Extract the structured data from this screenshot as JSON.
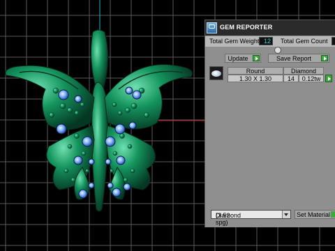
{
  "panel": {
    "title": "GEM REPORTER",
    "total_weight_label": "Total Gem Weight",
    "total_weight_value": "12",
    "total_count_label": "Total Gem Count",
    "update_label": "Update",
    "save_report_label": "Save Report",
    "table": {
      "columns": [
        "Round",
        "Diamond"
      ],
      "rows": [
        {
          "size": "1.30 X 1.30",
          "count": "14",
          "weight": "0.12tw"
        }
      ]
    },
    "material_select": {
      "value": "Diamond",
      "spg": "(3.52 spg)"
    },
    "set_material_label": "Set Material"
  },
  "colors": {
    "background": "#000000",
    "grid": "#5a5a5a",
    "model_green": "#0f7a4e",
    "gem_blue": "#7fb2ff",
    "axis_red": "#c81e1e",
    "axis_cyan": "#20b8c8",
    "panel_bg": "#8f8f8f",
    "accent_green": "#3fa73f"
  },
  "icons": {
    "app": "gem-reporter-app-icon",
    "play": "play-triangle-icon",
    "dropdown": "chevron-down-icon",
    "gem_thumbnail": "round-gem-icon"
  }
}
